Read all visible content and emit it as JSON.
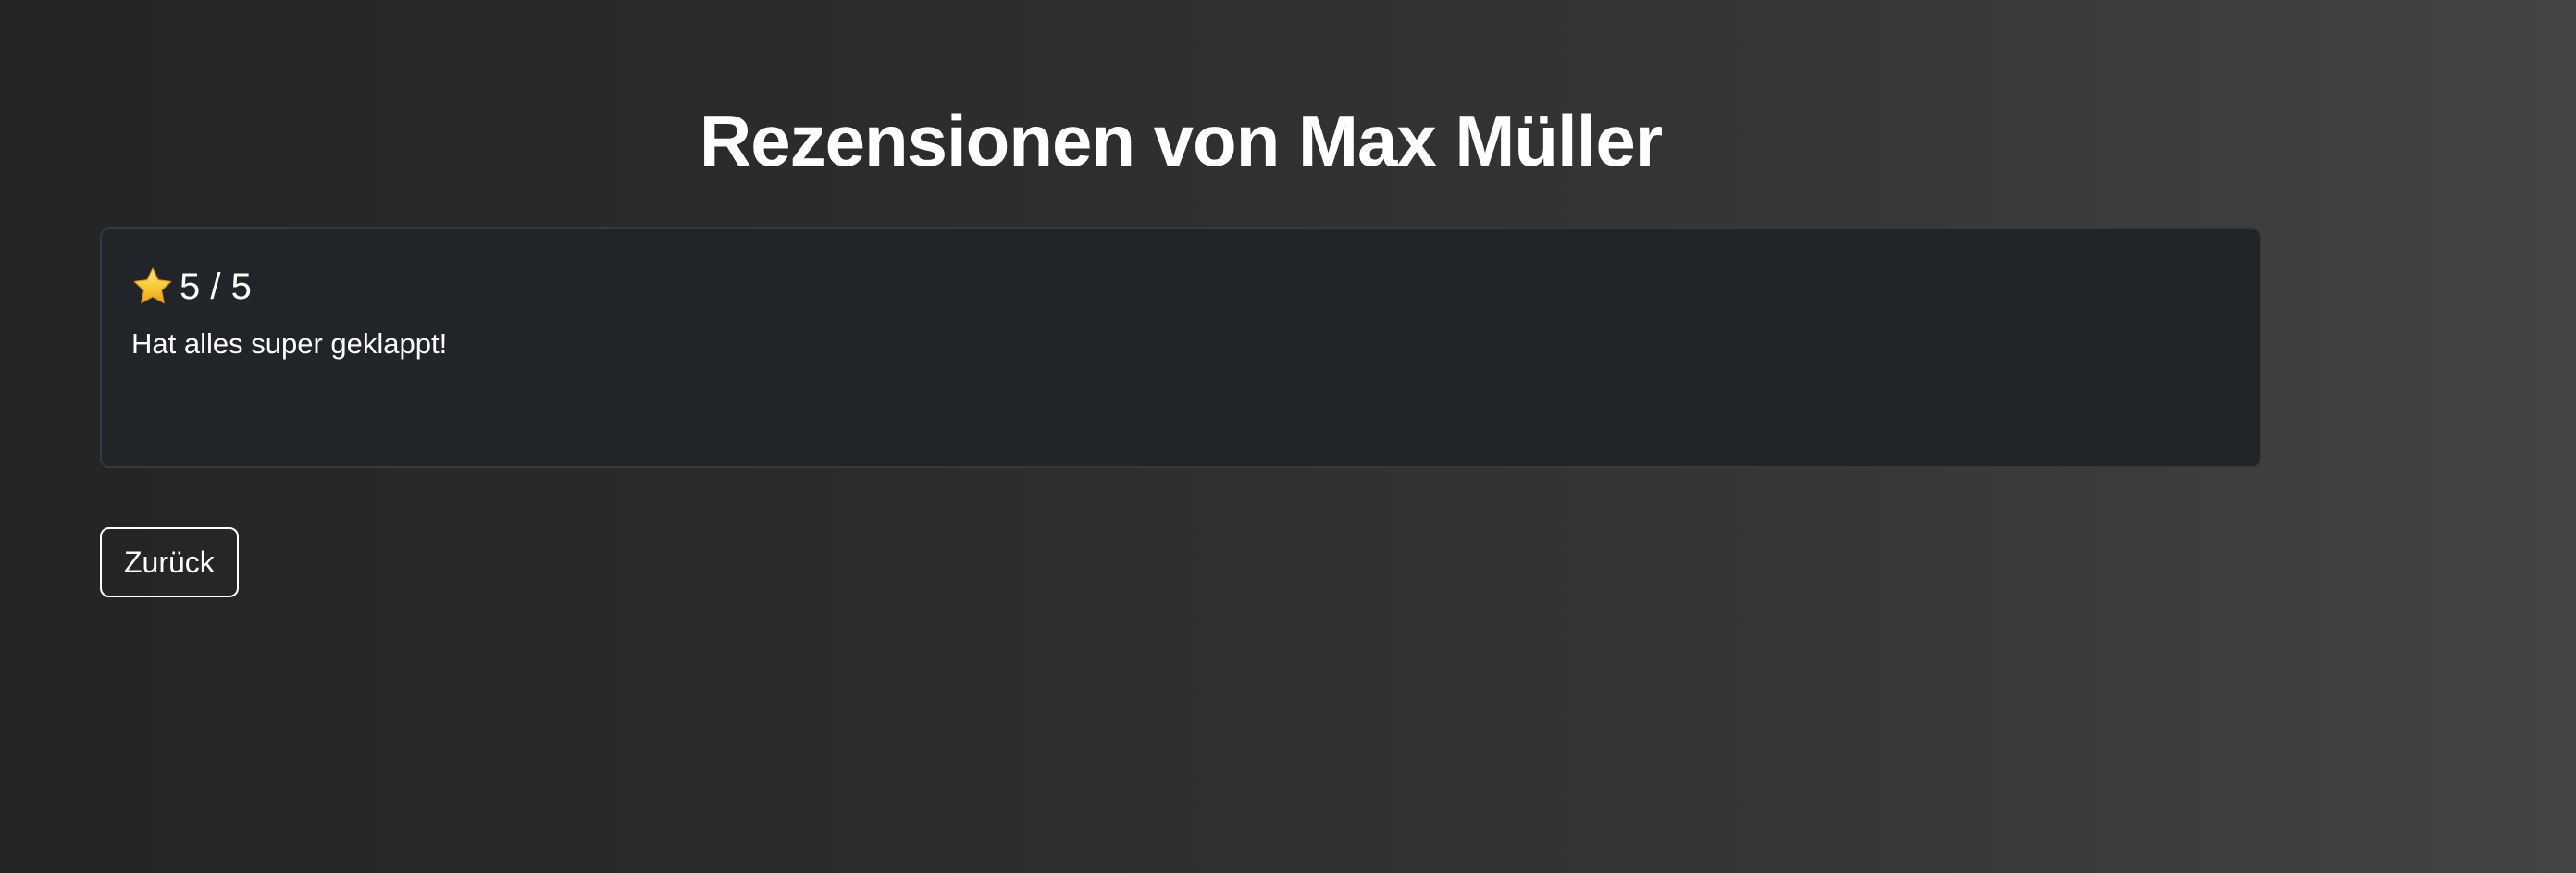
{
  "header": {
    "title": "Rezensionen von Max Müller"
  },
  "reviews": [
    {
      "icon": "star-icon",
      "rating_text": "5 / 5",
      "text": "Hat alles super geklappt!"
    }
  ],
  "actions": {
    "back_label": "Zurück"
  },
  "colors": {
    "card_background": "#212428",
    "star": "#f5c518",
    "text": "#ffffff"
  }
}
